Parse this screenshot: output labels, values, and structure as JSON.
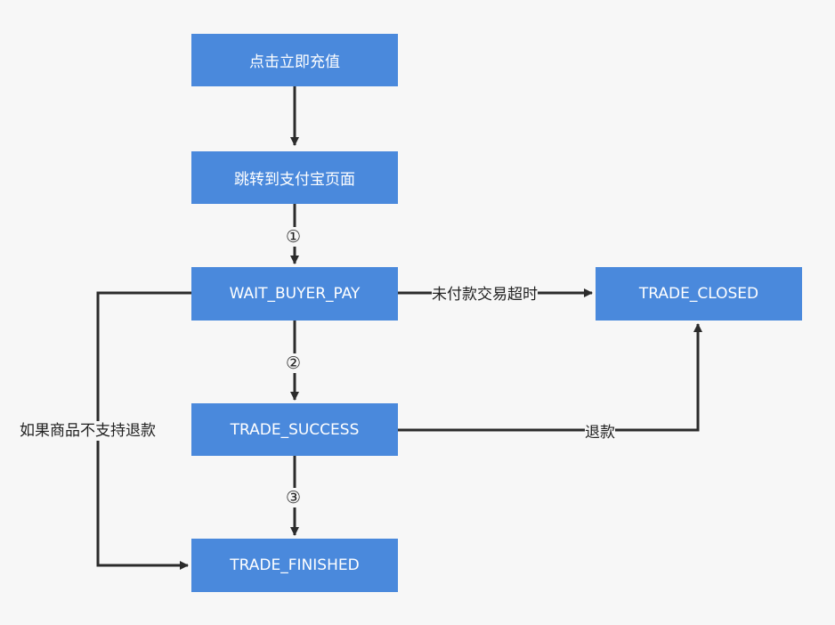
{
  "colors": {
    "node_fill": "#4a89dc",
    "node_text": "#ffffff",
    "edge": "#2b2b2b",
    "background": "#f7f7f7"
  },
  "nodes": {
    "click_recharge": "点击立即充值",
    "jump_alipay": "跳转到支付宝页面",
    "wait_buyer_pay": "WAIT_BUYER_PAY",
    "trade_closed": "TRADE_CLOSED",
    "trade_success": "TRADE_SUCCESS",
    "trade_finished": "TRADE_FINISHED"
  },
  "edge_labels": {
    "step1": "①",
    "step2": "②",
    "step3": "③",
    "timeout": "未付款交易超时",
    "refund": "退款",
    "no_refund": "如果商品不支持退款"
  }
}
